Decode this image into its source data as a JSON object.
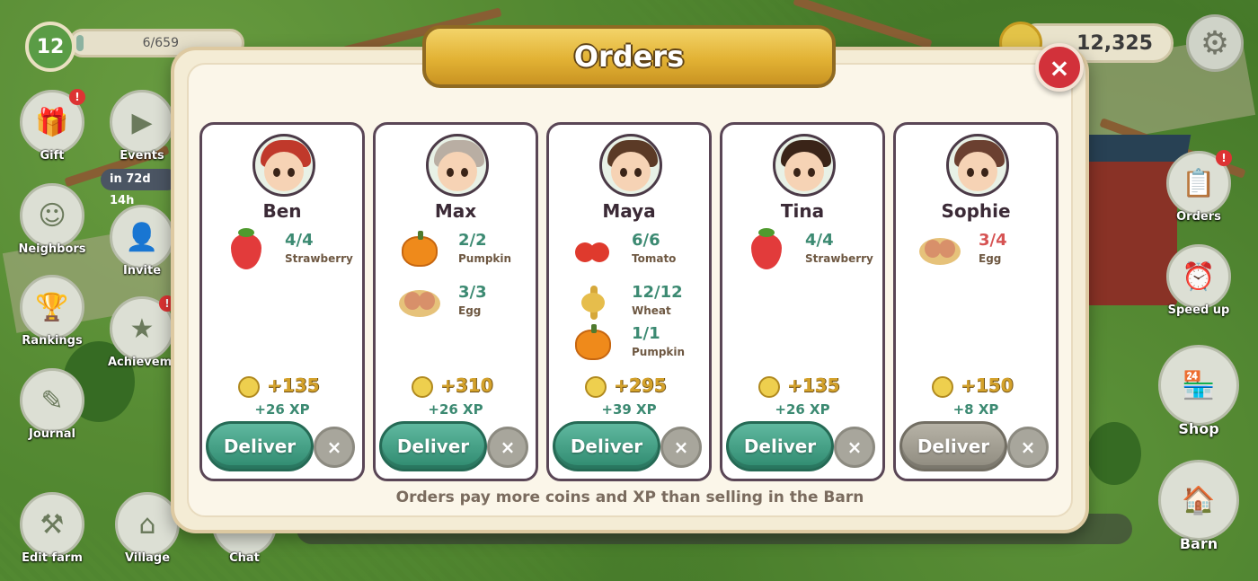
{
  "hud": {
    "level": "12",
    "xp_text": "6/659",
    "xp_fraction": 0.01,
    "coins": "12,325"
  },
  "sidebar_left": [
    {
      "label": "Gift",
      "icon": "gift-icon",
      "notify": "!"
    },
    {
      "label": "Events",
      "icon": "events-icon",
      "timer": "in 72d 14h"
    },
    {
      "label": "Neighbors",
      "icon": "neighbors-icon"
    },
    {
      "label": "Invite",
      "icon": "invite-icon"
    },
    {
      "label": "Rankings",
      "icon": "trophy-icon"
    },
    {
      "label": "Achievements",
      "icon": "star-icon",
      "notify": "!"
    },
    {
      "label": "Journal",
      "icon": "journal-icon"
    },
    {
      "label": "Edit farm",
      "icon": "edit-farm-icon"
    },
    {
      "label": "Village",
      "icon": "village-icon"
    },
    {
      "label": "Chat",
      "icon": "chat-icon"
    }
  ],
  "sidebar_right": [
    {
      "label": "Orders",
      "icon": "orders-icon",
      "notify": "!"
    },
    {
      "label": "Speed up",
      "icon": "clock-icon"
    },
    {
      "label": "Shop",
      "icon": "shop-icon"
    },
    {
      "label": "Barn",
      "icon": "barn-icon"
    }
  ],
  "modal": {
    "title": "Orders",
    "close_label": "×",
    "footer": "Orders pay more coins and XP than selling in the Barn",
    "orders": [
      {
        "name": "Ben",
        "avatar_hair": "#c0392b",
        "avatar_bg": "#e8f1e6",
        "items": [
          {
            "qty": "4/4",
            "name": "Strawberry",
            "icon": "strawberry",
            "complete": true
          }
        ],
        "coins": "+135",
        "xp": "+26 XP",
        "deliver_label": "Deliver",
        "deliver_enabled": true,
        "cancel_label": "×"
      },
      {
        "name": "Max",
        "avatar_hair": "#b9aea3",
        "avatar_bg": "#e8f1e6",
        "items": [
          {
            "qty": "2/2",
            "name": "Pumpkin",
            "icon": "pumpkin",
            "complete": true
          },
          {
            "qty": "3/3",
            "name": "Egg",
            "icon": "egg",
            "complete": true
          }
        ],
        "coins": "+310",
        "xp": "+26 XP",
        "deliver_label": "Deliver",
        "deliver_enabled": true,
        "cancel_label": "×"
      },
      {
        "name": "Maya",
        "avatar_hair": "#5b3a26",
        "avatar_bg": "#e8f1e6",
        "items": [
          {
            "qty": "6/6",
            "name": "Tomato",
            "icon": "tomato",
            "complete": true
          },
          {
            "qty": "12/12",
            "name": "Wheat",
            "icon": "wheat",
            "complete": true
          },
          {
            "qty": "1/1",
            "name": "Pumpkin",
            "icon": "pumpkin",
            "complete": true
          }
        ],
        "coins": "+295",
        "xp": "+39 XP",
        "deliver_label": "Deliver",
        "deliver_enabled": true,
        "cancel_label": "×"
      },
      {
        "name": "Tina",
        "avatar_hair": "#3a2418",
        "avatar_bg": "#e8f1e6",
        "items": [
          {
            "qty": "4/4",
            "name": "Strawberry",
            "icon": "strawberry",
            "complete": true
          }
        ],
        "coins": "+135",
        "xp": "+26 XP",
        "deliver_label": "Deliver",
        "deliver_enabled": true,
        "cancel_label": "×"
      },
      {
        "name": "Sophie",
        "avatar_hair": "#6b4030",
        "avatar_bg": "#e8f1e6",
        "items": [
          {
            "qty": "3/4",
            "name": "Egg",
            "icon": "egg",
            "complete": false
          }
        ],
        "coins": "+150",
        "xp": "+8 XP",
        "deliver_label": "Deliver",
        "deliver_enabled": false,
        "cancel_label": "×"
      }
    ]
  }
}
